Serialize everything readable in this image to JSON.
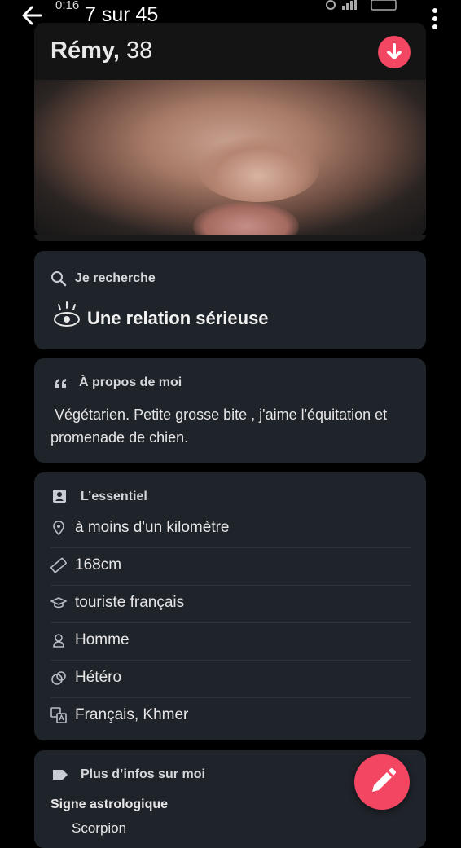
{
  "status": {
    "time": "0:16",
    "battery": "115"
  },
  "topbar": {
    "counter": "7 sur 45"
  },
  "profile": {
    "name": "Rémy,",
    "age": "38"
  },
  "looking_for": {
    "title": "Je recherche",
    "value": "Une relation sérieuse"
  },
  "about": {
    "title": "À propos de moi",
    "text": "Végétarien. Petite grosse bite , j'aime l'équitation et promenade de chien."
  },
  "essentials": {
    "title": "L’essentiel",
    "items": [
      {
        "icon": "location-pin-icon",
        "label": "à moins d'un kilomètre"
      },
      {
        "icon": "ruler-icon",
        "label": "168cm"
      },
      {
        "icon": "graduation-cap-icon",
        "label": "touriste français"
      },
      {
        "icon": "person-icon",
        "label": "Homme"
      },
      {
        "icon": "gender-icon",
        "label": "Hétéro"
      },
      {
        "icon": "translate-icon",
        "label": "Français, Khmer"
      }
    ]
  },
  "more_info": {
    "title": "Plus d’infos sur moi",
    "subtitle": "Signe astrologique",
    "value": "Scorpion"
  },
  "colors": {
    "accent": "#f24662",
    "card": "#1f232a",
    "background": "#000000"
  }
}
